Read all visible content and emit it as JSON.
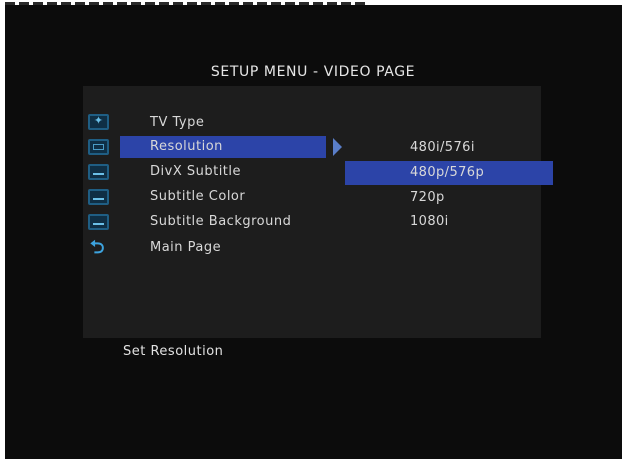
{
  "title": "SETUP MENU - VIDEO PAGE",
  "menu": {
    "items": [
      {
        "label": "TV Type",
        "icon": "tv-type-icon"
      },
      {
        "label": "Resolution",
        "icon": "resolution-icon"
      },
      {
        "label": "DivX Subtitle",
        "icon": "subtitle-icon"
      },
      {
        "label": "Subtitle Color",
        "icon": "subtitle-color-icon"
      },
      {
        "label": "Subtitle Background",
        "icon": "subtitle-background-icon"
      },
      {
        "label": "Main Page",
        "icon": "back-arrow-icon"
      }
    ],
    "selected": "Resolution"
  },
  "options": {
    "items": [
      "480i/576i",
      "480p/576p",
      "720p",
      "1080i"
    ],
    "selected": "480p/576p"
  },
  "status": "Set Resolution",
  "colors": {
    "highlight": "#2c44a8",
    "panel": "#1d1d1d",
    "background": "#0c0c0c",
    "icon_accent": "#3da3de"
  }
}
